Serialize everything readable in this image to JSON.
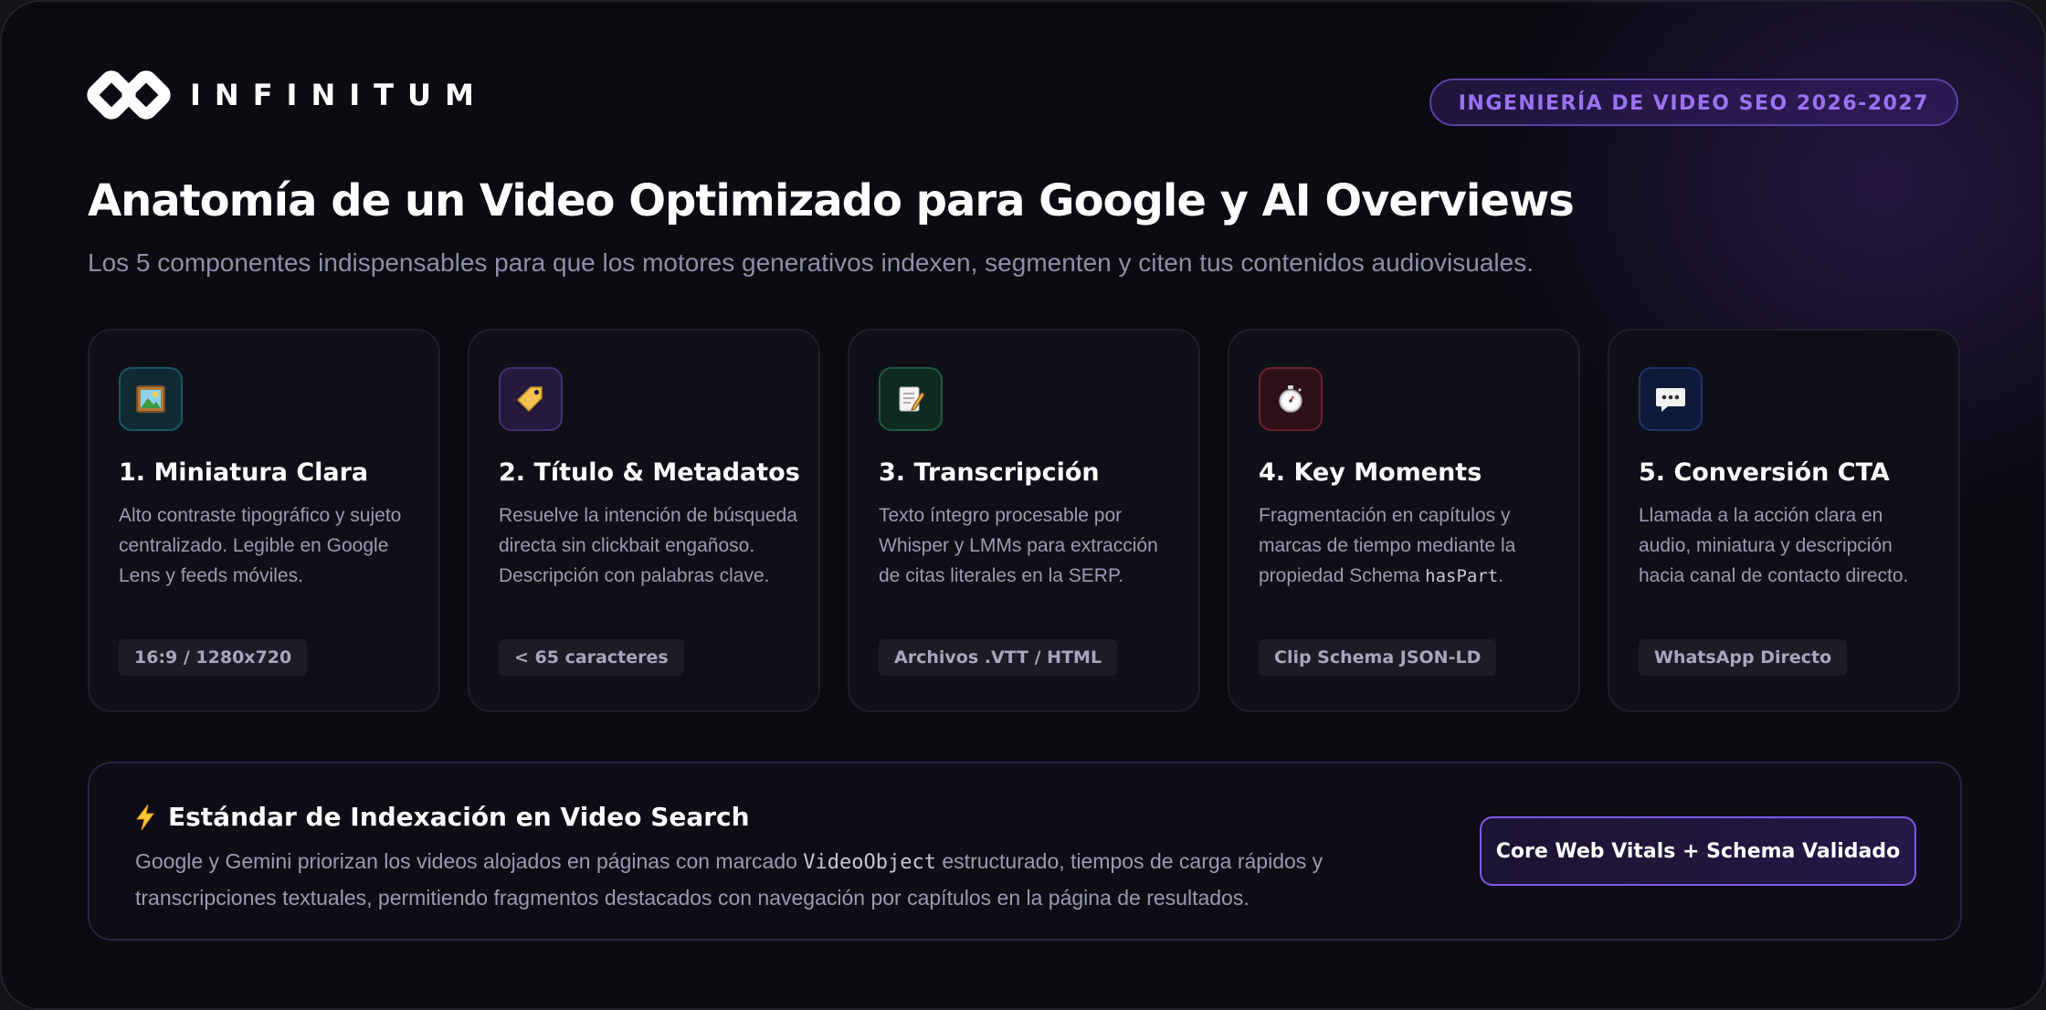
{
  "brand": {
    "name": "INFINITUM",
    "logo_icon": "infinity-logo-icon"
  },
  "badge": "INGENIERÍA DE VIDEO SEO 2026-2027",
  "header": {
    "title": "Anatomía de un Video Optimizado para Google y AI Overviews",
    "subtitle": "Los 5 componentes indispensables para que los motores generativos indexen, segmenten y citen tus contenidos audiovisuales."
  },
  "cards": [
    {
      "icon": "framed-picture-icon",
      "title": "1. Miniatura Clara",
      "desc": "Alto contraste tipográfico y sujeto centralizado. Legible en Google Lens y feeds móviles.",
      "tag": "16:9 / 1280x720"
    },
    {
      "icon": "label-tag-icon",
      "title": "2. Título & Metadatos",
      "desc": "Resuelve la intención de búsqueda directa sin clickbait engañoso. Descripción con palabras clave.",
      "tag": "< 65 caracteres"
    },
    {
      "icon": "memo-icon",
      "title": "3. Transcripción",
      "desc": "Texto íntegro procesable por Whisper y LMMs para extracción de citas literales en la SERP.",
      "tag": "Archivos .VTT / HTML"
    },
    {
      "icon": "stopwatch-icon",
      "title": "4. Key Moments",
      "desc_before": "Fragmentación en capítulos y marcas de tiempo mediante la propiedad Schema ",
      "desc_code": "hasPart",
      "desc_after": ".",
      "tag": "Clip Schema JSON-LD"
    },
    {
      "icon": "speech-bubble-icon",
      "title": "5. Conversión CTA",
      "desc": "Llamada a la acción clara en audio, miniatura y descripción hacia canal de contacto directo.",
      "tag": "WhatsApp Directo"
    }
  ],
  "footer": {
    "icon": "lightning-icon",
    "title": "Estándar de Indexación en Video Search",
    "desc_before": "Google y Gemini priorizan los videos alojados en páginas con marcado ",
    "desc_code": "VideoObject",
    "desc_after": " estructurado, tiempos de carga rápidos y transcripciones textuales, permitiendo fragmentos destacados con navegación por capítulos en la página de resultados.",
    "button_label": "Core Web Vitals + Schema Validado"
  },
  "colors": {
    "accent": "#7e5be8",
    "badge_text": "#9a72f2",
    "background": "#0b0b12"
  }
}
